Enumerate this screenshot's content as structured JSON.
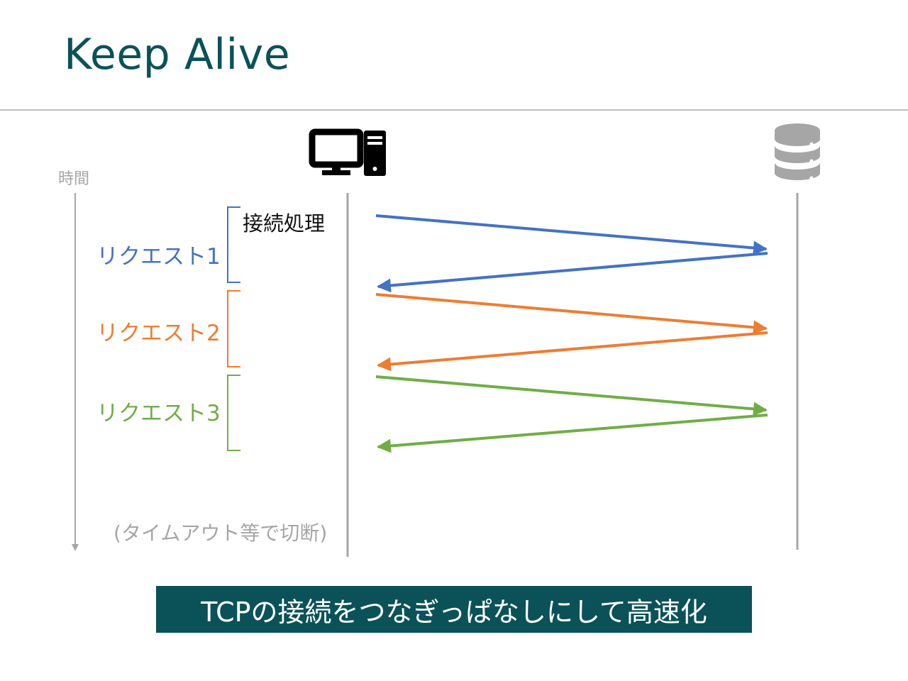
{
  "title": "Keep Alive",
  "time_label": "時間",
  "connection_label": "接続処理",
  "requests": [
    {
      "label": "リクエスト1",
      "color": "#4472c4"
    },
    {
      "label": "リクエスト2",
      "color": "#ed7d31"
    },
    {
      "label": "リクエスト3",
      "color": "#70ad47"
    }
  ],
  "timeout_label": "(タイムアウト等で切断)",
  "banner": "TCPの接続をつなぎっぱなしにして高速化",
  "icons": {
    "client": "desktop-computer-icon",
    "server": "database-server-icon"
  },
  "colors": {
    "title": "#0b5258",
    "banner_bg": "#0b5258",
    "timeline": "#a6a6a6"
  }
}
